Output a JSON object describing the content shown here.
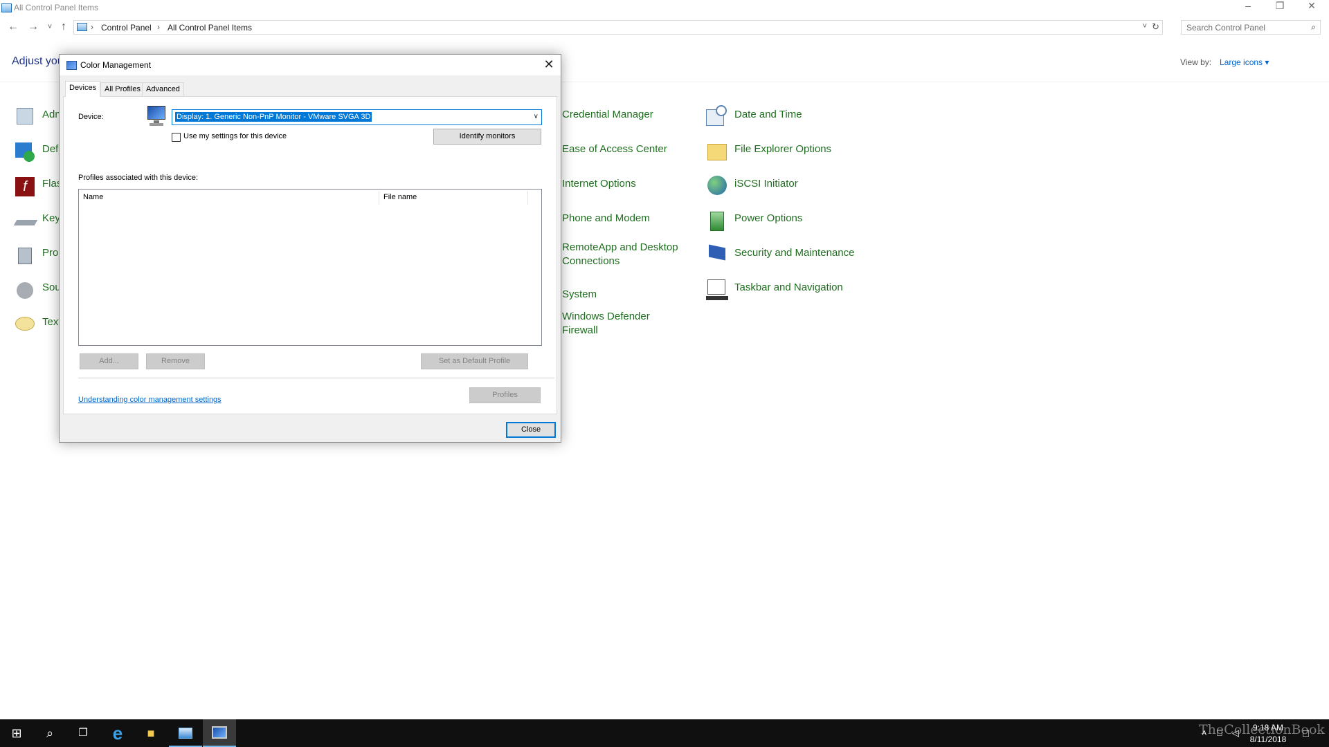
{
  "window": {
    "title": "All Control Panel Items",
    "minimize_glyph": "–",
    "restore_glyph": "❐",
    "close_glyph": "✕"
  },
  "address": {
    "back_glyph": "←",
    "forward_glyph": "→",
    "recent_glyph": "˅",
    "up_glyph": "↑",
    "crumbs": [
      "Control Panel",
      "All Control Panel Items"
    ],
    "sep_glyph": "›",
    "dropdown_glyph": "˅",
    "refresh_glyph": "↻"
  },
  "search": {
    "placeholder": "Search Control Panel",
    "icon_glyph": "⌕"
  },
  "header": {
    "heading": "Adjust you",
    "view_by_label": "View by:",
    "view_by_value": "Large icons ▾"
  },
  "left_items": [
    "Adm",
    "Def",
    "Flas",
    "Key",
    "Pro",
    "Sou",
    "Text"
  ],
  "middle_items": [
    "Credential Manager",
    "Ease of Access Center",
    "Internet Options",
    "Phone and Modem",
    "RemoteApp and Desktop Connections",
    "System",
    "Windows Defender Firewall"
  ],
  "right_items": [
    "Date and Time",
    "File Explorer Options",
    "iSCSI Initiator",
    "Power Options",
    "Security and Maintenance",
    "Taskbar and Navigation"
  ],
  "dialog": {
    "title": "Color Management",
    "close_glyph": "✕",
    "tabs": [
      "Devices",
      "All Profiles",
      "Advanced"
    ],
    "device_label": "Device:",
    "device_value": "Display: 1. Generic Non-PnP Monitor - VMware SVGA 3D",
    "dropdown_glyph": "∨",
    "use_settings_label": "Use my settings for this device",
    "identify_button": "Identify monitors",
    "profiles_label": "Profiles associated with this device:",
    "columns": [
      "Name",
      "File name"
    ],
    "add_button": "Add...",
    "remove_button": "Remove",
    "set_default_button": "Set as Default Profile",
    "profiles_button": "Profiles",
    "help_link": "Understanding color management settings",
    "close_button": "Close"
  },
  "taskbar": {
    "start_glyph": "⊞",
    "search_glyph": "⌕",
    "taskview_glyph": "❐",
    "ie_glyph": "e",
    "explorer_glyph": "■",
    "time": "9:18 AM",
    "date": "8/11/2018",
    "chevron_glyph": "˄",
    "network_glyph": "⎕",
    "volume_glyph": "◁",
    "notif_glyph": "□"
  },
  "watermark": "TheCollectionBook",
  "colors": {
    "link_green": "#1f6e1f",
    "accent_blue": "#0078d7",
    "taskbar": "#101010"
  }
}
